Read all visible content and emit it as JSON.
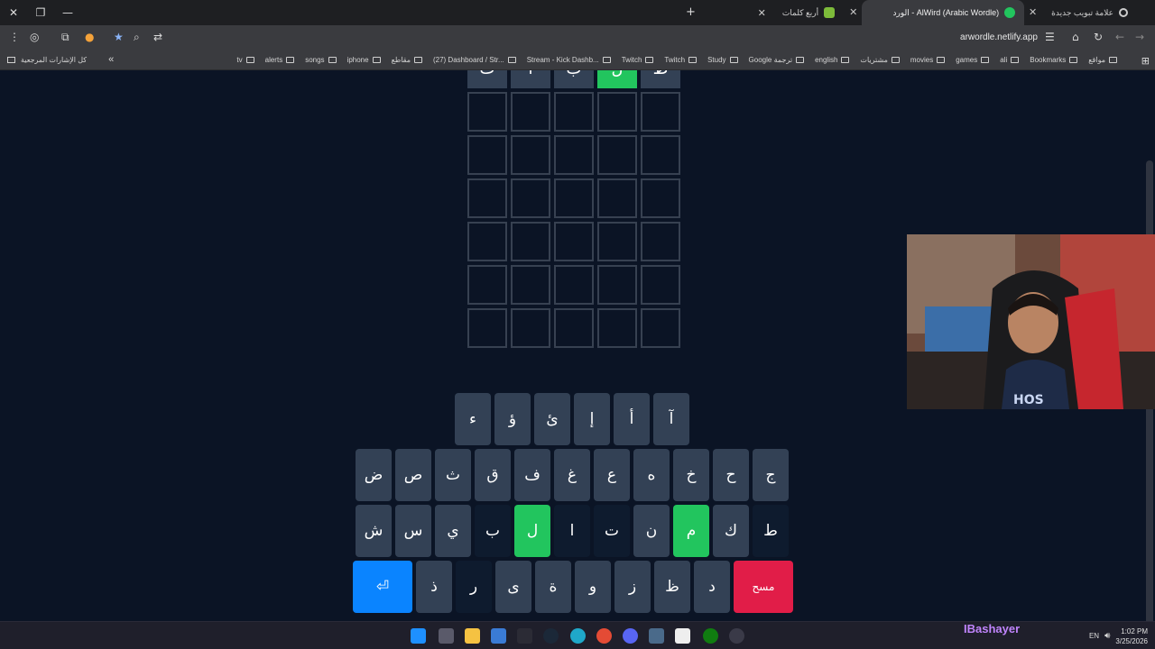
{
  "browser": {
    "tabs": [
      {
        "title": "علامة تبويب جديدة",
        "active": false
      },
      {
        "title": "AlWird (Arabic Wordle) - الورد",
        "active": true
      },
      {
        "title": "أربع كلمات",
        "active": false
      }
    ],
    "url": "arwordle.netlify.app",
    "bookmarks": [
      "مواقع",
      "Bookmarks",
      "ali",
      "games",
      "movies",
      "مشتريات",
      "english",
      "Google ترجمة",
      "Study",
      "Twitch",
      "Twitch",
      "Stream - Kick Dashb...",
      "(27) Dashboard / Str...",
      "مقاطع",
      "iphone",
      "songs",
      "alerts",
      "tv"
    ],
    "all_bookmarks_label": "كل الإشارات المرجعية",
    "overflow_icon": "double-chevron-icon"
  },
  "game": {
    "board": [
      [
        {
          "letter": "ط",
          "state": "filled"
        },
        {
          "letter": "ل",
          "state": "green"
        },
        {
          "letter": "ب",
          "state": "filled"
        },
        {
          "letter": "ا",
          "state": "filled"
        },
        {
          "letter": "ت",
          "state": "filled"
        }
      ],
      [
        {
          "letter": "",
          "state": "empty"
        },
        {
          "letter": "",
          "state": "empty"
        },
        {
          "letter": "",
          "state": "empty"
        },
        {
          "letter": "",
          "state": "empty"
        },
        {
          "letter": "",
          "state": "empty"
        }
      ],
      [
        {
          "letter": "",
          "state": "empty"
        },
        {
          "letter": "",
          "state": "empty"
        },
        {
          "letter": "",
          "state": "empty"
        },
        {
          "letter": "",
          "state": "empty"
        },
        {
          "letter": "",
          "state": "empty"
        }
      ],
      [
        {
          "letter": "",
          "state": "empty"
        },
        {
          "letter": "",
          "state": "empty"
        },
        {
          "letter": "",
          "state": "empty"
        },
        {
          "letter": "",
          "state": "empty"
        },
        {
          "letter": "",
          "state": "empty"
        }
      ],
      [
        {
          "letter": "",
          "state": "empty"
        },
        {
          "letter": "",
          "state": "empty"
        },
        {
          "letter": "",
          "state": "empty"
        },
        {
          "letter": "",
          "state": "empty"
        },
        {
          "letter": "",
          "state": "empty"
        }
      ],
      [
        {
          "letter": "",
          "state": "empty"
        },
        {
          "letter": "",
          "state": "empty"
        },
        {
          "letter": "",
          "state": "empty"
        },
        {
          "letter": "",
          "state": "empty"
        },
        {
          "letter": "",
          "state": "empty"
        }
      ],
      [
        {
          "letter": "",
          "state": "empty"
        },
        {
          "letter": "",
          "state": "empty"
        },
        {
          "letter": "",
          "state": "empty"
        },
        {
          "letter": "",
          "state": "empty"
        },
        {
          "letter": "",
          "state": "empty"
        }
      ]
    ],
    "keyboard": {
      "row1": [
        {
          "k": "آ",
          "s": "normal"
        },
        {
          "k": "أ",
          "s": "normal"
        },
        {
          "k": "إ",
          "s": "normal"
        },
        {
          "k": "ئ",
          "s": "normal"
        },
        {
          "k": "ؤ",
          "s": "normal"
        },
        {
          "k": "ء",
          "s": "normal"
        }
      ],
      "row2": [
        {
          "k": "ج",
          "s": "normal"
        },
        {
          "k": "ح",
          "s": "normal"
        },
        {
          "k": "خ",
          "s": "normal"
        },
        {
          "k": "ه",
          "s": "normal"
        },
        {
          "k": "ع",
          "s": "normal"
        },
        {
          "k": "غ",
          "s": "normal"
        },
        {
          "k": "ف",
          "s": "normal"
        },
        {
          "k": "ق",
          "s": "normal"
        },
        {
          "k": "ث",
          "s": "normal"
        },
        {
          "k": "ص",
          "s": "normal"
        },
        {
          "k": "ض",
          "s": "normal"
        }
      ],
      "row3": [
        {
          "k": "ط",
          "s": "dark"
        },
        {
          "k": "ك",
          "s": "normal"
        },
        {
          "k": "م",
          "s": "green"
        },
        {
          "k": "ن",
          "s": "normal"
        },
        {
          "k": "ت",
          "s": "dark"
        },
        {
          "k": "ا",
          "s": "dark"
        },
        {
          "k": "ل",
          "s": "green"
        },
        {
          "k": "ب",
          "s": "dark"
        },
        {
          "k": "ي",
          "s": "normal"
        },
        {
          "k": "س",
          "s": "normal"
        },
        {
          "k": "ش",
          "s": "normal"
        }
      ],
      "row4": [
        {
          "k": "مسح",
          "s": "del"
        },
        {
          "k": "د",
          "s": "normal"
        },
        {
          "k": "ظ",
          "s": "normal"
        },
        {
          "k": "ز",
          "s": "normal"
        },
        {
          "k": "و",
          "s": "normal"
        },
        {
          "k": "ة",
          "s": "normal"
        },
        {
          "k": "ى",
          "s": "normal"
        },
        {
          "k": "ر",
          "s": "dark"
        },
        {
          "k": "ذ",
          "s": "normal"
        },
        {
          "k": "⏎",
          "s": "enter"
        }
      ]
    }
  },
  "taskbar": {
    "streamer_name": "IBashayer",
    "time": "1:02 PM",
    "date": "3/25/2026",
    "lang": "EN"
  },
  "colors": {
    "bg": "#0b1425",
    "green": "#22c55e",
    "key": "#334155",
    "enter": "#0a84ff",
    "delete": "#e11d48"
  }
}
